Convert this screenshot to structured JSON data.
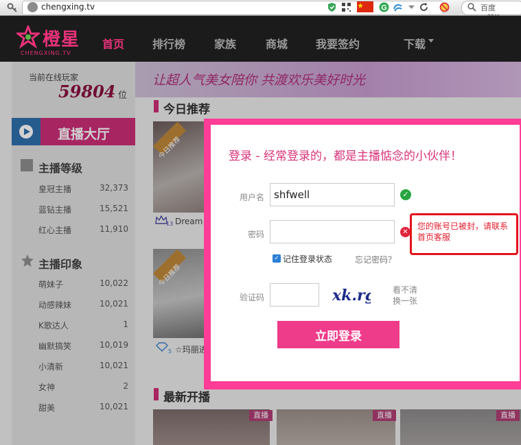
{
  "browser": {
    "url": "chengxing.tv",
    "search_placeholder": "百度 <⌘K>"
  },
  "site": {
    "logo_text": "橙星",
    "logo_sub": "CHENGXING.TV",
    "nav": [
      "首页",
      "排行榜",
      "家族",
      "商城",
      "我要签约",
      "下载"
    ]
  },
  "sidebar": {
    "online_label": "当前在线玩家",
    "online_count": "59804",
    "online_unit": "位",
    "live_hall": "直播大厅",
    "level_title": "主播等级",
    "levels": [
      {
        "name": "皇冠主播",
        "count": "32,373"
      },
      {
        "name": "蓝钻主播",
        "count": "15,521"
      },
      {
        "name": "红心主播",
        "count": "11,910"
      }
    ],
    "impression_title": "主播印象",
    "impressions": [
      {
        "name": "萌妹子",
        "count": "10,022"
      },
      {
        "name": "动感辣妹",
        "count": "10,021"
      },
      {
        "name": "K歌达人",
        "count": "1"
      },
      {
        "name": "幽默搞笑",
        "count": "10,019"
      },
      {
        "name": "小清新",
        "count": "10,021"
      },
      {
        "name": "女神",
        "count": "2"
      },
      {
        "name": "甜美",
        "count": "10,021"
      }
    ]
  },
  "main": {
    "banner_text": "让超人气美女陪你 共渡欢乐美好时光",
    "today_title": "今日推荐",
    "today_tag": "今日推荐",
    "card1_level": "13",
    "card1_name": "Dream",
    "card2_level": "5",
    "card2_name": "☆玛丽进",
    "latest_title": "最新开播",
    "live_tag": "直播"
  },
  "login": {
    "title": "登录 - 经常登录的，都是主播惦念的小伙伴！",
    "username_label": "用户名",
    "username_value": "shfwell",
    "password_label": "密码",
    "error_text": "您的账号已被封，请联系首页客服",
    "remember_label": "记住登录状态",
    "forgot_label": "忘记密码？",
    "captcha_label": "验证码",
    "captcha_text": "xk.rg",
    "refresh_line1": "看不清",
    "refresh_line2": "换一张",
    "submit_label": "立即登录"
  },
  "colors": {
    "brand_pink": "#e8327a",
    "modal_border": "#ff3d96",
    "error_red": "#e3121b",
    "success_green": "#27a53f"
  }
}
